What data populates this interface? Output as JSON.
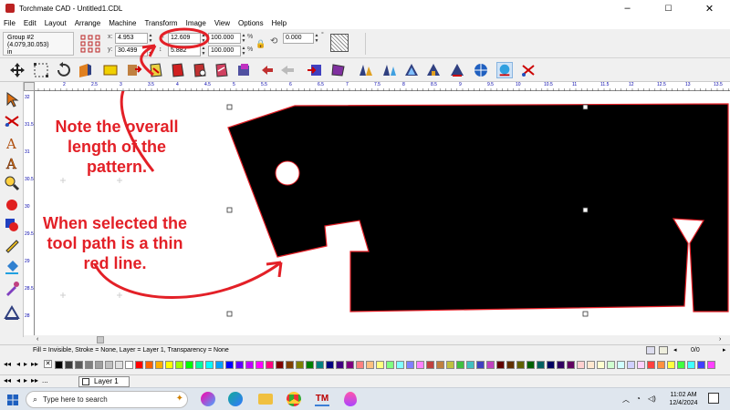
{
  "window": {
    "title": "Torchmate CAD - Untitled1.CDL",
    "controls": [
      "–",
      "☐",
      "✕"
    ]
  },
  "menu": [
    "File",
    "Edit",
    "Layout",
    "Arrange",
    "Machine",
    "Transform",
    "Image",
    "View",
    "Options",
    "Help"
  ],
  "properties": {
    "object_name": "Group #2",
    "position": "(4.079,30.053)",
    "units": "in",
    "x_label": "x:",
    "x_value": "4.953",
    "y_label": "y:",
    "y_value": "30.499",
    "width_value": "12.609",
    "height_value": "5.882",
    "scale_w": "100.000",
    "scale_h": "100.000",
    "percent": "%",
    "rotation": "0.000",
    "degree": "°"
  },
  "ruler": {
    "h_ticks": [
      "2",
      "2.5",
      "3",
      "3.5",
      "4",
      "4.5",
      "5",
      "5.5",
      "6",
      "6.5",
      "7",
      "7.5",
      "8",
      "8.5",
      "9",
      "9.5",
      "10",
      "10.5",
      "11",
      "11.5",
      "12",
      "12.5",
      "13",
      "13.5"
    ],
    "v_ticks": [
      "32",
      "31.5",
      "31",
      "30.5",
      "30",
      "29.5",
      "29",
      "28.5",
      "28"
    ]
  },
  "status": {
    "text": "Fill = Invisible, Stroke = None, Layer = Layer 1, Transparency = None",
    "page_count": "0/0"
  },
  "page_tabs": {
    "nav_more": "...",
    "layer_tab": "Layer 1"
  },
  "taskbar": {
    "search_placeholder": "Type here to search",
    "time": "11:02 AM",
    "date": "12/4/2024"
  },
  "annotations": {
    "note1": "Note the overall length of the pattern.",
    "note2": "When selected the tool path is a thin red line."
  },
  "colors": {
    "annotation": "#e32027",
    "toolpath": "#e32027",
    "shape_fill": "#000000",
    "ruler_text": "#0000aa",
    "palette": [
      "#000000",
      "#3a3a3a",
      "#5a5a5a",
      "#808080",
      "#a0a0a0",
      "#c0c0c0",
      "#e0e0e0",
      "#ffffff",
      "#ff0000",
      "#ff6000",
      "#ffb000",
      "#ffff00",
      "#a0ff00",
      "#00ff00",
      "#00ffa0",
      "#00ffff",
      "#00a0ff",
      "#0000ff",
      "#6000ff",
      "#c000ff",
      "#ff00ff",
      "#ff0080",
      "#800000",
      "#804000",
      "#808000",
      "#008000",
      "#008080",
      "#000080",
      "#400080",
      "#800080",
      "#ff8080",
      "#ffc080",
      "#ffff80",
      "#80ff80",
      "#80ffff",
      "#8080ff",
      "#ff80ff",
      "#c04040",
      "#c08040",
      "#c0c040",
      "#40c040",
      "#40c0c0",
      "#4040c0",
      "#c040c0",
      "#600000",
      "#603000",
      "#606000",
      "#006000",
      "#006060",
      "#000060",
      "#300060",
      "#600060",
      "#ffd0d0",
      "#ffe8d0",
      "#ffffd0",
      "#d0ffd0",
      "#d0ffff",
      "#d0d0ff",
      "#ffd0ff",
      "#ff4040",
      "#ff9040",
      "#ffff40",
      "#40ff40",
      "#40ffff",
      "#4040ff",
      "#ff40ff"
    ]
  },
  "icons": {
    "toolbar": [
      "move-icon",
      "node-icon",
      "undo-icon",
      "import-icon",
      "plate-icon",
      "lead-in-icon",
      "cut-icon",
      "tab-icon",
      "order-icon",
      "rotate-icon",
      "redo-icon",
      "post-icon",
      "layer-icon",
      "path-icon",
      "kerf-icon",
      "nest-icon",
      "chain-icon",
      "target-icon",
      "sim-icon",
      "tool-icon"
    ],
    "toolbox": [
      "pointer-icon",
      "shape-icon",
      "text-icon",
      "text-art-icon",
      "zoom-icon",
      "fill-icon",
      "color-icon",
      "pen-icon",
      "paint-bucket-icon",
      "eyedropper-icon",
      "measure-icon"
    ]
  }
}
